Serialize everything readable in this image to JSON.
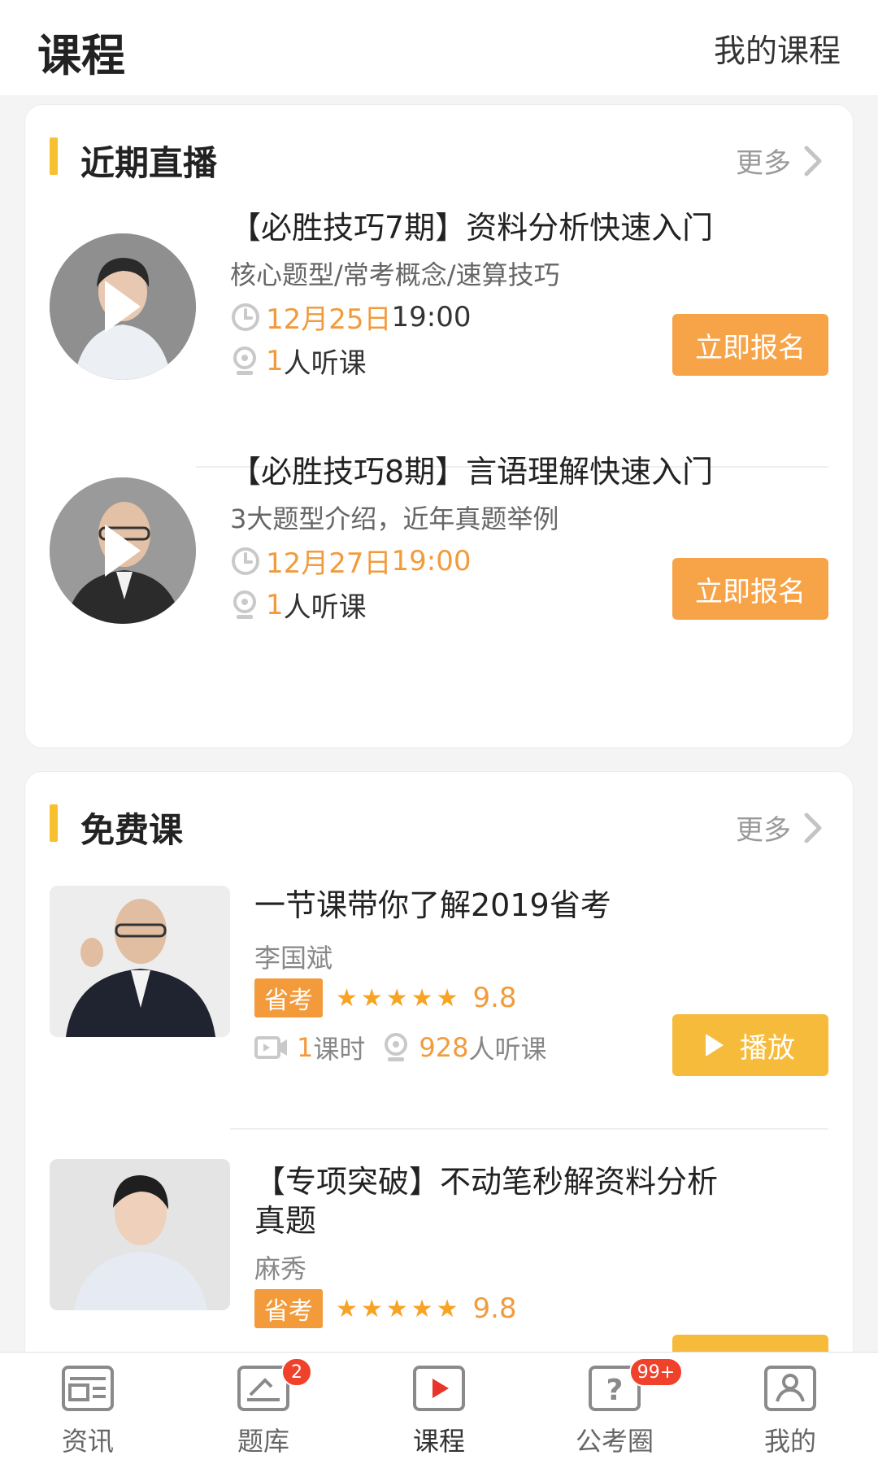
{
  "header": {
    "title": "课程",
    "my_courses": "我的课程"
  },
  "live_section": {
    "title": "近期直播",
    "more": "更多",
    "items": [
      {
        "title": "【必胜技巧7期】资料分析快速入门",
        "desc": "核心题型/常考概念/速算技巧",
        "date": "12月25日",
        "time": " 19:00",
        "listeners": "1",
        "listen_suffix": "人听课",
        "button": "立即报名"
      },
      {
        "title": "【必胜技巧8期】言语理解快速入门",
        "desc": "3大题型介绍，近年真题举例",
        "date": "12月27日",
        "time": "19:00",
        "listeners": "1",
        "listen_suffix": "人听课",
        "button": "立即报名"
      }
    ]
  },
  "free_section": {
    "title": "免费课",
    "more": "更多",
    "items": [
      {
        "title": "一节课带你了解2019省考",
        "teacher": "李国斌",
        "tag": "省考",
        "stars": "★★★★★",
        "score": "9.8",
        "lessons": "1",
        "lessons_suffix": "课时",
        "listeners": "928",
        "listen_suffix": "人听课",
        "button": "播放"
      },
      {
        "title": "【专项突破】不动笔秒解资料分析真题",
        "teacher": "麻秀",
        "tag": "省考",
        "stars": "★★★★★",
        "score": "9.8"
      }
    ]
  },
  "tabbar": {
    "tabs": [
      {
        "label": "资讯",
        "icon": "news-icon"
      },
      {
        "label": "题库",
        "icon": "question-bank-icon",
        "badge": "2"
      },
      {
        "label": "课程",
        "icon": "course-play-icon"
      },
      {
        "label": "公考圈",
        "icon": "community-question-icon",
        "badge": "99+"
      },
      {
        "label": "我的",
        "icon": "profile-icon"
      }
    ]
  },
  "colors": {
    "accent_orange": "#f7a348",
    "play_yellow": "#f7bb3c",
    "badge_red": "#f0412b",
    "active_tab_red": "#e8342a"
  }
}
